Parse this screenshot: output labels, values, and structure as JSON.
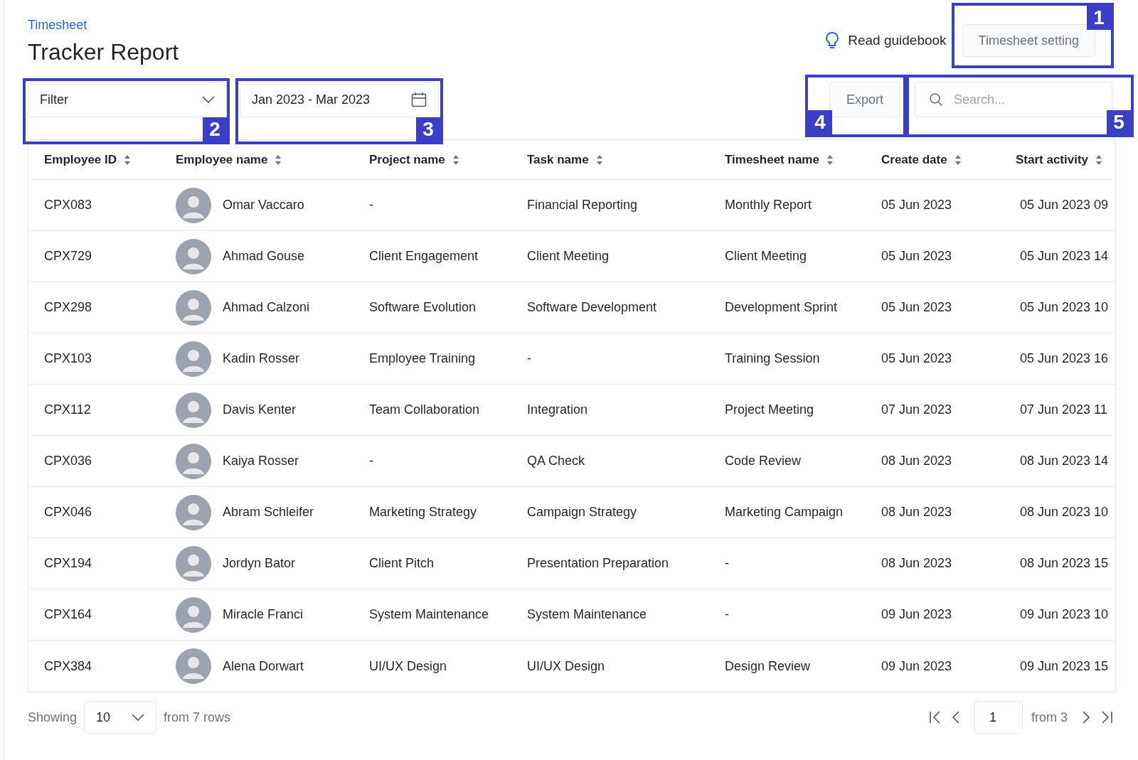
{
  "breadcrumb": "Timesheet",
  "title": "Tracker Report",
  "guidebook_link": "Read guidebook",
  "settings_button": {
    "label": "Timesheet setting",
    "callout": "1"
  },
  "filter": {
    "value": "Filter",
    "callout": "2"
  },
  "date_range": {
    "value": "Jan 2023 - Mar 2023",
    "callout": "3"
  },
  "export_button": {
    "label": "Export",
    "callout": "4"
  },
  "search": {
    "placeholder": "Search...",
    "callout": "5"
  },
  "table": {
    "columns": [
      "Employee ID",
      "Employee name",
      "Project name",
      "Task name",
      "Timesheet name",
      "Create date",
      "Start activity"
    ],
    "rows": [
      {
        "id": "CPX083",
        "name": "Omar Vaccaro",
        "project": "-",
        "task": "Financial Reporting",
        "timesheet": "Monthly Report",
        "created": "05 Jun 2023",
        "start": "05 Jun 2023 09"
      },
      {
        "id": "CPX729",
        "name": "Ahmad Gouse",
        "project": "Client Engagement",
        "task": "Client Meeting",
        "timesheet": "Client Meeting",
        "created": "05 Jun 2023",
        "start": "05 Jun 2023 14"
      },
      {
        "id": "CPX298",
        "name": "Ahmad Calzoni",
        "project": "Software Evolution",
        "task": "Software Development",
        "timesheet": "Development Sprint",
        "created": "05 Jun 2023",
        "start": "05 Jun 2023 10"
      },
      {
        "id": "CPX103",
        "name": "Kadin Rosser",
        "project": "Employee Training",
        "task": "-",
        "timesheet": "Training Session",
        "created": "05 Jun 2023",
        "start": "05 Jun 2023 16"
      },
      {
        "id": "CPX112",
        "name": "Davis Kenter",
        "project": "Team Collaboration",
        "task": "Integration",
        "timesheet": "Project Meeting",
        "created": "07 Jun 2023",
        "start": "07 Jun 2023 11"
      },
      {
        "id": "CPX036",
        "name": "Kaiya Rosser",
        "project": "-",
        "task": "QA Check",
        "timesheet": "Code Review",
        "created": "08 Jun 2023",
        "start": "08 Jun 2023 14"
      },
      {
        "id": "CPX046",
        "name": "Abram Schleifer",
        "project": "Marketing Strategy",
        "task": "Campaign Strategy",
        "timesheet": "Marketing Campaign",
        "created": "08 Jun 2023",
        "start": "08 Jun 2023 10"
      },
      {
        "id": "CPX194",
        "name": "Jordyn Bator",
        "project": "Client Pitch",
        "task": "Presentation Preparation",
        "timesheet": "-",
        "created": "08 Jun 2023",
        "start": "08 Jun 2023 15"
      },
      {
        "id": "CPX164",
        "name": "Miracle Franci",
        "project": "System Maintenance",
        "task": "System Maintenance",
        "timesheet": "-",
        "created": "09 Jun 2023",
        "start": "09 Jun 2023 10"
      },
      {
        "id": "CPX384",
        "name": "Alena Dorwart",
        "project": "UI/UX Design",
        "task": "UI/UX Design",
        "timesheet": "Design Review",
        "created": "09 Jun 2023",
        "start": "09 Jun 2023 15"
      }
    ]
  },
  "pagination": {
    "showing_label": "Showing",
    "page_size": "10",
    "rows_label": "from 7 rows",
    "page": "1",
    "pages_label": "from 3"
  }
}
